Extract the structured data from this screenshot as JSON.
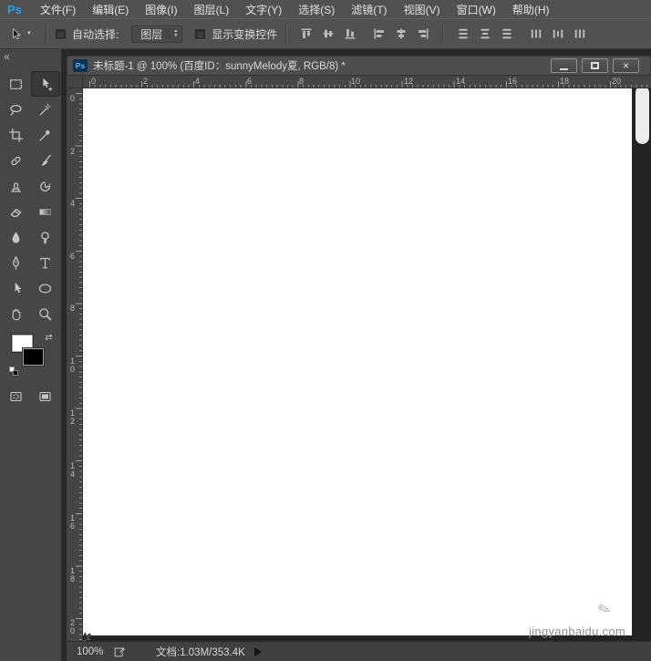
{
  "app": {
    "logo": "Ps"
  },
  "menubar": {
    "items": [
      "文件(F)",
      "编辑(E)",
      "图像(I)",
      "图层(L)",
      "文字(Y)",
      "选择(S)",
      "滤镜(T)",
      "视图(V)",
      "窗口(W)",
      "帮助(H)"
    ]
  },
  "options_bar": {
    "tool_icon": "move-tool-cursor-icon",
    "auto_select_label": "自动选择:",
    "auto_select_checked": false,
    "target_dropdown_value": "图层",
    "show_transform_label": "显示变换控件",
    "show_transform_checked": false,
    "align_buttons": [
      "align-top-edges",
      "align-vertical-centers",
      "align-bottom-edges",
      "align-left-edges",
      "align-horizontal-centers",
      "align-right-edges",
      "distribute-top-edges",
      "distribute-vertical-centers",
      "distribute-bottom-edges",
      "distribute-left-edges",
      "distribute-horizontal-centers",
      "distribute-right-edges"
    ]
  },
  "tool_panel": {
    "collapse_glyph": "«",
    "tools": [
      "rectangular-marquee-tool",
      "move-tool",
      "lasso-tool",
      "magic-wand-tool",
      "crop-tool",
      "eyedropper-tool",
      "spot-healing-brush-tool",
      "brush-tool",
      "clone-stamp-tool",
      "history-brush-tool",
      "eraser-tool",
      "gradient-tool",
      "blur-tool",
      "dodge-tool",
      "pen-tool",
      "type-tool",
      "path-selection-tool",
      "ellipse-tool",
      "hand-tool",
      "zoom-tool",
      "quick-mask-mode",
      "screen-mode"
    ],
    "foreground_color": "#ffffff",
    "background_color": "#000000"
  },
  "document_window": {
    "tab_badge": "Ps",
    "title": "未标题-1 @ 100% (百度ID：sunnyMelody夏, RGB/8) *",
    "close_glyph": "×"
  },
  "rulers": {
    "horizontal": [
      "0",
      "2",
      "4",
      "6",
      "8",
      "10",
      "12",
      "14",
      "16",
      "18",
      "20"
    ],
    "vertical": [
      "0",
      "2",
      "4",
      "6",
      "8",
      "10",
      "12",
      "14",
      "16",
      "18",
      "20"
    ]
  },
  "status_bar": {
    "zoom": "100%",
    "doc_info": "文档:1.03M/353.4K"
  },
  "watermark": {
    "text": "jingyanbaidu.com"
  },
  "colors": {
    "menubar_bg": "#515151",
    "panel_bg": "#464646",
    "app_bg": "#282828",
    "canvas": "#ffffff",
    "accent_blue": "#2f9ee8",
    "icon_gray": "#c6c6c6"
  }
}
